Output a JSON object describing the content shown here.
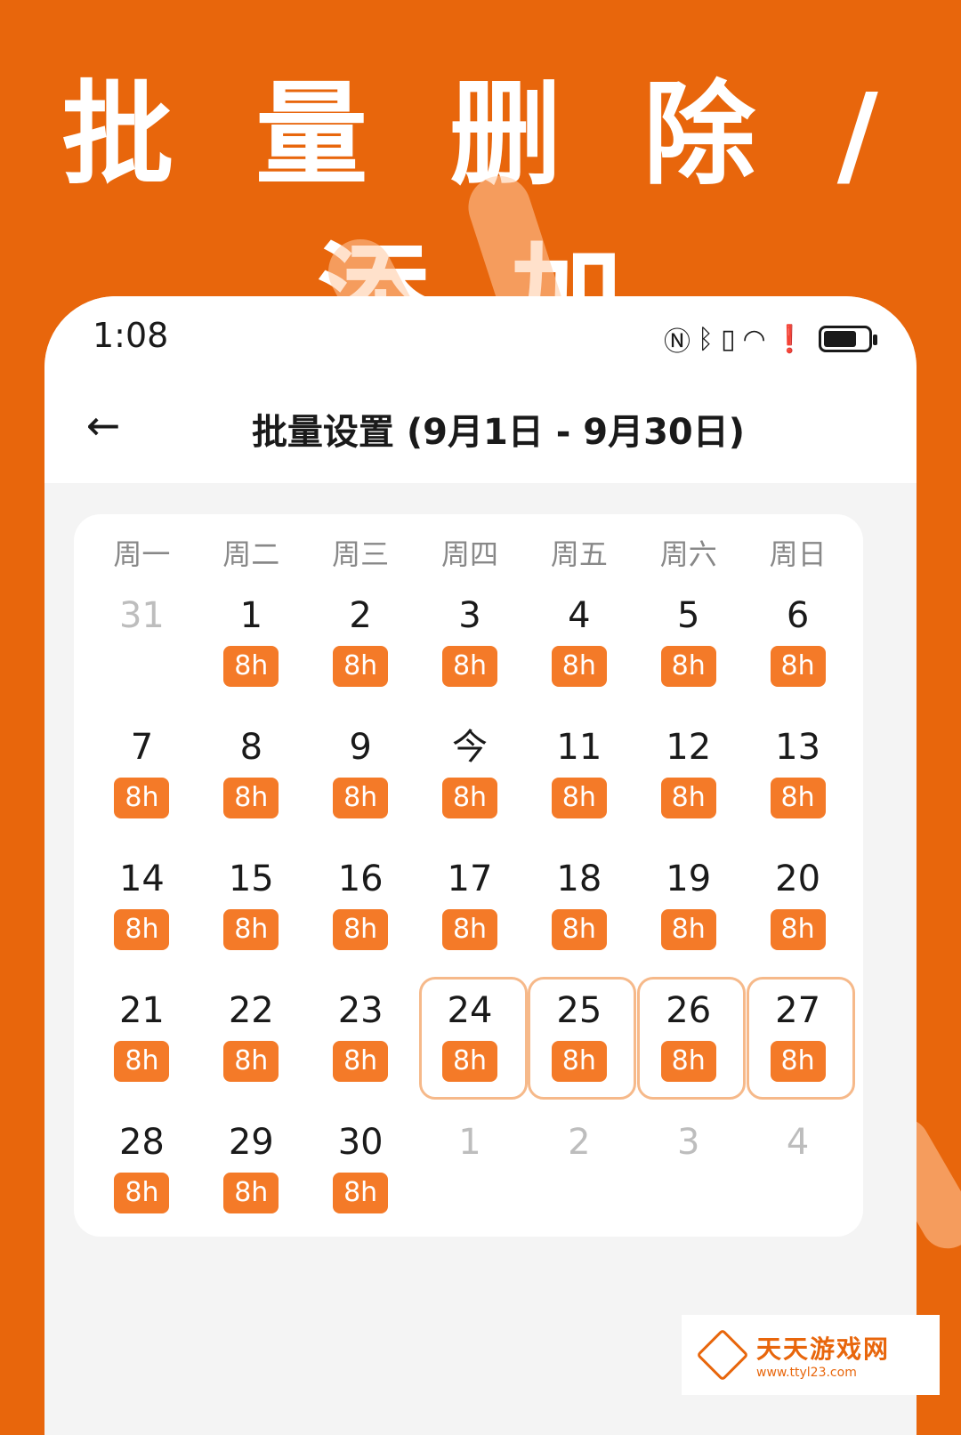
{
  "promo": {
    "headline": "批 量 删 除 / 添 加"
  },
  "status_bar": {
    "time": "1:08"
  },
  "header": {
    "back_icon": "arrow-left-icon",
    "title": "批量设置 (9月1日 - 9月30日)"
  },
  "calendar": {
    "weekdays": [
      "周一",
      "周二",
      "周三",
      "周四",
      "周五",
      "周六",
      "周日"
    ],
    "rows": [
      [
        {
          "day": "31",
          "hours": "",
          "muted": true
        },
        {
          "day": "1",
          "hours": "8h"
        },
        {
          "day": "2",
          "hours": "8h"
        },
        {
          "day": "3",
          "hours": "8h"
        },
        {
          "day": "4",
          "hours": "8h"
        },
        {
          "day": "5",
          "hours": "8h"
        },
        {
          "day": "6",
          "hours": "8h"
        }
      ],
      [
        {
          "day": "7",
          "hours": "8h"
        },
        {
          "day": "8",
          "hours": "8h"
        },
        {
          "day": "9",
          "hours": "8h"
        },
        {
          "day": "今",
          "hours": "8h"
        },
        {
          "day": "11",
          "hours": "8h"
        },
        {
          "day": "12",
          "hours": "8h"
        },
        {
          "day": "13",
          "hours": "8h"
        }
      ],
      [
        {
          "day": "14",
          "hours": "8h"
        },
        {
          "day": "15",
          "hours": "8h"
        },
        {
          "day": "16",
          "hours": "8h"
        },
        {
          "day": "17",
          "hours": "8h"
        },
        {
          "day": "18",
          "hours": "8h"
        },
        {
          "day": "19",
          "hours": "8h"
        },
        {
          "day": "20",
          "hours": "8h"
        }
      ],
      [
        {
          "day": "21",
          "hours": "8h"
        },
        {
          "day": "22",
          "hours": "8h"
        },
        {
          "day": "23",
          "hours": "8h"
        },
        {
          "day": "24",
          "hours": "8h",
          "selected": true
        },
        {
          "day": "25",
          "hours": "8h",
          "selected": true
        },
        {
          "day": "26",
          "hours": "8h",
          "selected": true
        },
        {
          "day": "27",
          "hours": "8h",
          "selected": true
        }
      ],
      [
        {
          "day": "28",
          "hours": "8h"
        },
        {
          "day": "29",
          "hours": "8h"
        },
        {
          "day": "30",
          "hours": "8h"
        },
        {
          "day": "1",
          "hours": "",
          "muted": true
        },
        {
          "day": "2",
          "hours": "",
          "muted": true
        },
        {
          "day": "3",
          "hours": "",
          "muted": true
        },
        {
          "day": "4",
          "hours": "",
          "muted": true
        }
      ]
    ]
  },
  "watermark": {
    "name": "天天游戏网",
    "url": "www.ttyl23.com"
  },
  "colors": {
    "brand_orange": "#E8660C",
    "badge_orange": "#F47A28",
    "selected_border": "#F6B98A"
  }
}
